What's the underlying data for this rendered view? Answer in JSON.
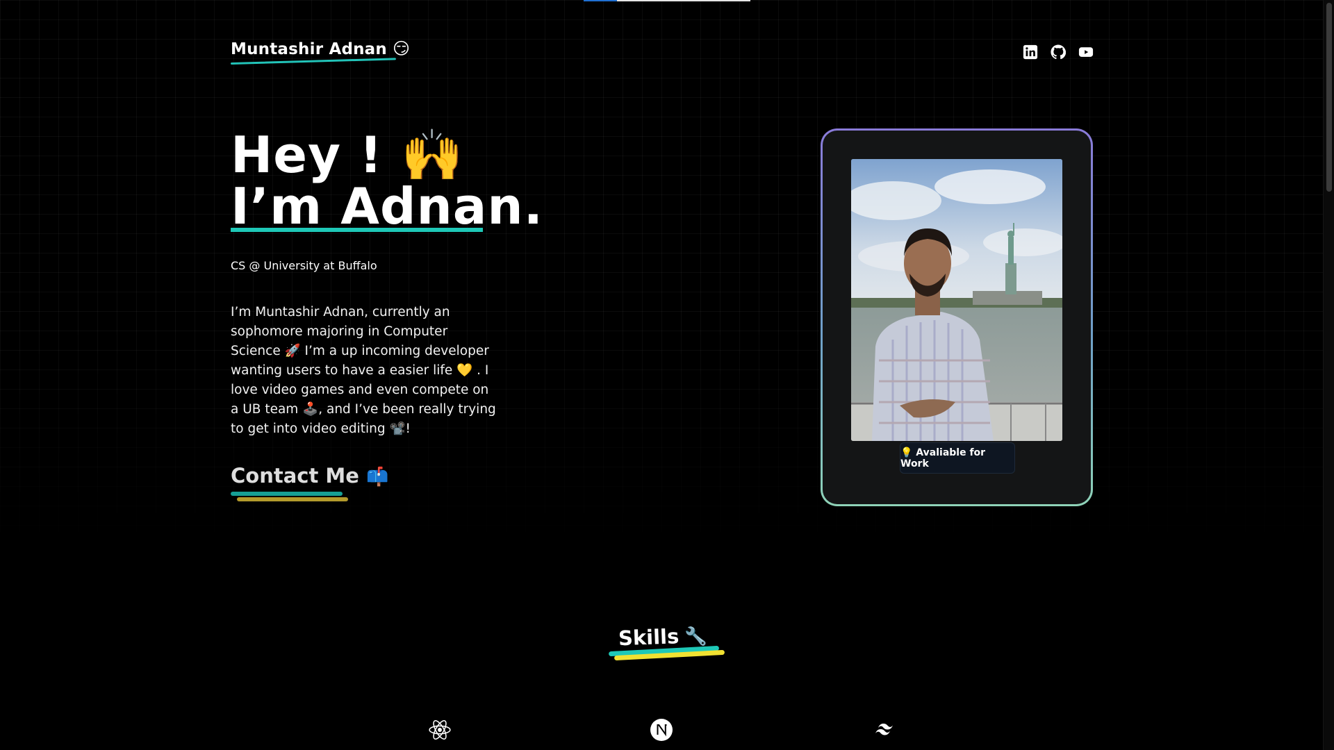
{
  "scroll_progress": 0.2,
  "header": {
    "name": "Muntashir Adnan",
    "emoji": "😏",
    "socials": [
      {
        "name": "linkedin-icon"
      },
      {
        "name": "github-icon"
      },
      {
        "name": "youtube-icon"
      }
    ]
  },
  "hero": {
    "title_line1": "Hey ! 🙌",
    "title_line2": "I’m Adnan.",
    "subtitle": "CS @ University at Buffalo",
    "bio": "I’m Muntashir Adnan, currently an sophomore majoring in Computer Science 🚀 I’m a up incoming developer wanting users to have a easier life 💛 . I love video games and even compete on a UB team 🕹️, and I’ve been really trying to get into video editing 📽️!",
    "contact_label": "Contact Me",
    "contact_emoji": "📫"
  },
  "profile_card": {
    "badge": "💡 Avaliable for Work"
  },
  "skills": {
    "title": "Skills",
    "emoji": "🔧",
    "icons": [
      "react-icon",
      "nextjs-icon",
      "tailwind-icon"
    ]
  },
  "colors": {
    "accent_teal": "#1ec8b7",
    "accent_yellow": "#f1e132",
    "background": "#000000"
  }
}
